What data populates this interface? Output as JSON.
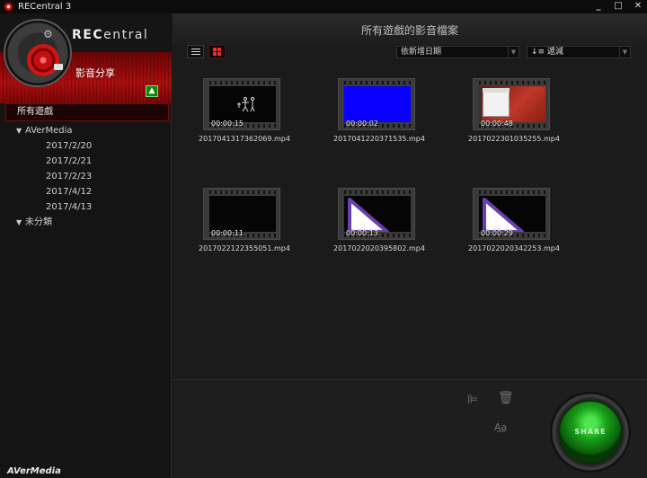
{
  "window": {
    "title": "RECentral 3",
    "minimize": "_",
    "maximize": "□",
    "close": "✕"
  },
  "sidebar": {
    "brand": "REC",
    "brand_thin": "entral",
    "section_title": "影音分享",
    "upload_icon": "up-arrow-icon",
    "tree_root": "所有遊戲",
    "tree": [
      {
        "label": "AVerMedia",
        "children": [
          "2017/2/20",
          "2017/2/21",
          "2017/2/23",
          "2017/4/12",
          "2017/4/13"
        ]
      },
      {
        "label": "未分類",
        "children": []
      }
    ],
    "footer_brand": "AVerMedia"
  },
  "main": {
    "title": "所有遊戲的影音檔案",
    "sort_by": "依新增日期",
    "order": "遞減",
    "share_label": "SHARE"
  },
  "videos": [
    {
      "duration": "00:00:15",
      "filename": "2017041317362069.mp4",
      "preview": "black-figures"
    },
    {
      "duration": "00:00:02",
      "filename": "2017041220371535.mp4",
      "preview": "blue"
    },
    {
      "duration": "00:00:48",
      "filename": "2017022301035255.mp4",
      "preview": "desktop"
    },
    {
      "duration": "00:00:11",
      "filename": "2017022122355051.mp4",
      "preview": "black"
    },
    {
      "duration": "00:00:13",
      "filename": "2017022020395802.mp4",
      "preview": "play-logo"
    },
    {
      "duration": "00:00:29",
      "filename": "2017022020342253.mp4",
      "preview": "play-logo"
    }
  ],
  "colors": {
    "accent_red": "#a80e0e",
    "share_green": "#19a019",
    "blue_preview": "#0000ff",
    "play_purple": "#6a3fb0"
  }
}
